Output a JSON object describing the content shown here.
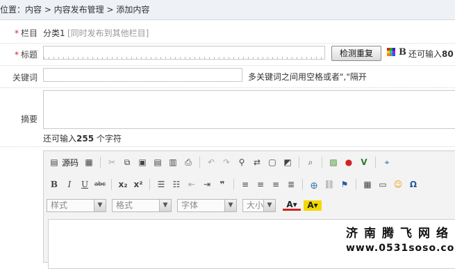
{
  "breadcrumb": "位置：内容 > 内容发布管理 > 添加内容",
  "form": {
    "column": {
      "label": "栏目",
      "value": "分类1",
      "hint": "[同时发布到其他栏目]"
    },
    "title": {
      "label": "标题",
      "check_button": "检测重复",
      "bold_label": "B",
      "remain_prefix": "还可输入",
      "remain_count": "80"
    },
    "keywords": {
      "label": "关键词",
      "hint": "多关键词之间用空格或者\",\"隔开"
    },
    "summary": {
      "label": "摘要",
      "remain_prefix": "还可输入",
      "remain_count": "255",
      "remain_suffix": "个字符"
    }
  },
  "editor": {
    "source_label": "源码",
    "style_combo": "样式",
    "format_combo": "格式",
    "font_combo": "字体",
    "size_combo": "大小",
    "colors": {
      "accent_red": "#d22222",
      "highlight_yellow": "#f5d800"
    }
  },
  "watermark": {
    "line1": "济南腾飞网络",
    "line2": "www.0531soso.com"
  }
}
